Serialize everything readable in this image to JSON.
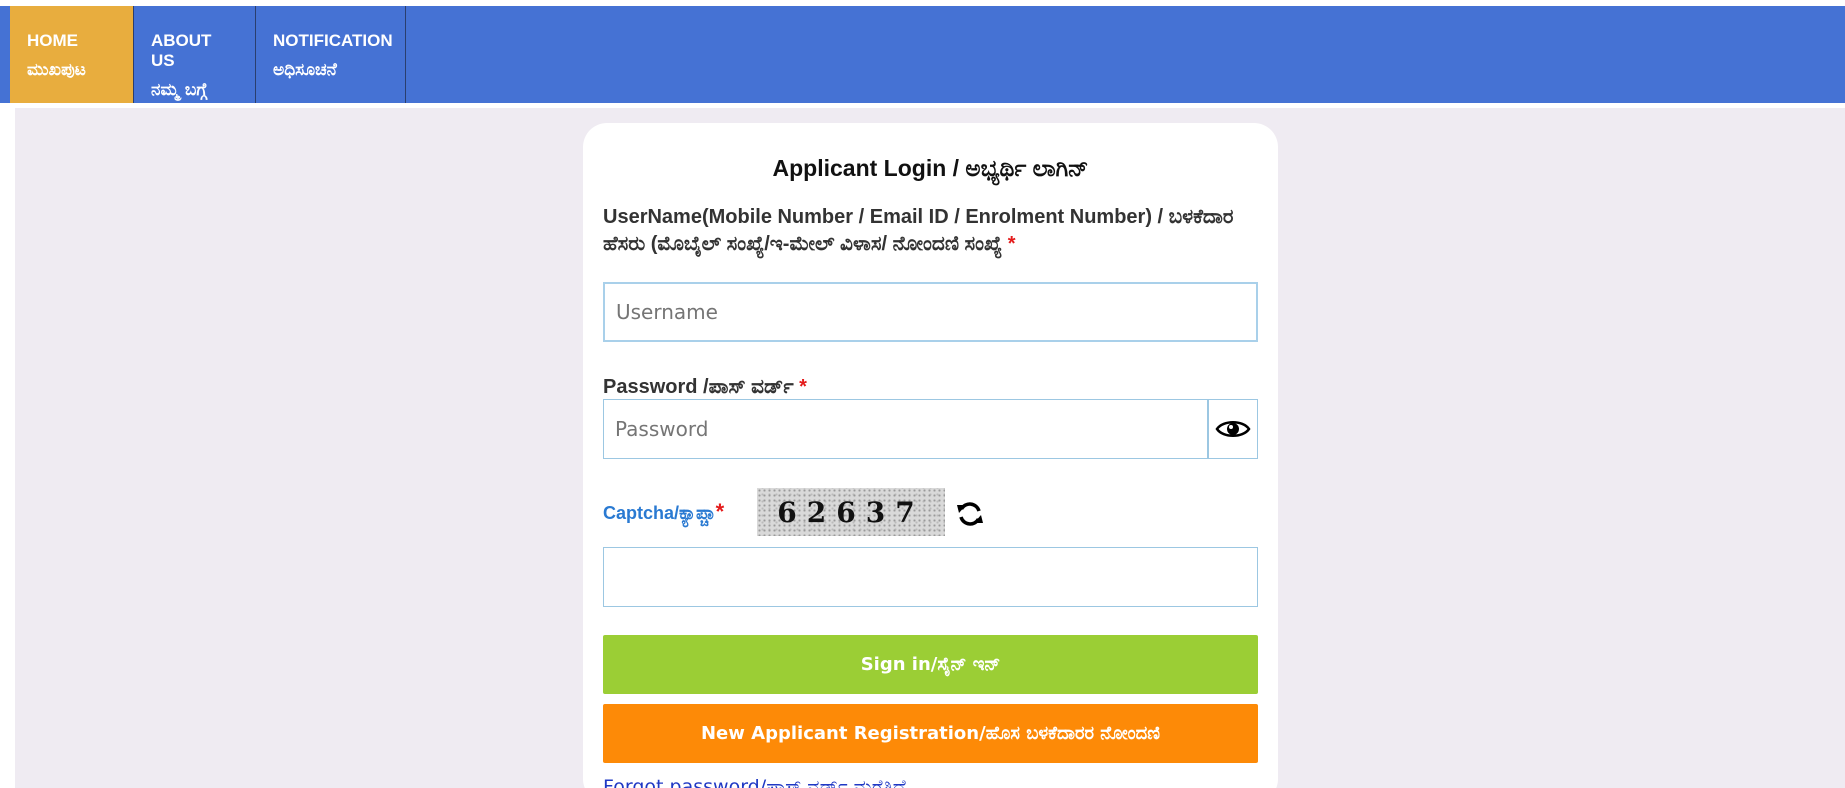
{
  "nav": {
    "home": {
      "en": "HOME",
      "kn": "ಮುಖಪುಟ"
    },
    "about": {
      "en": "ABOUT US",
      "kn": "ನಮ್ಮ ಬಗ್ಗೆ"
    },
    "notification": {
      "en": "NOTIFICATION",
      "kn": "ಅಧಿಸೂಚನೆ"
    }
  },
  "login": {
    "title": "Applicant Login / ಅಭ್ಯರ್ಥಿ ಲಾಗಿನ್",
    "username_label": "UserName(Mobile Number / Email ID / Enrolment Number) / ಬಳಕೆದಾರ ಹೆಸರು (ಮೊಬೈಲ್ ಸಂಖ್ಯೆ/ಇ-ಮೇಲ್ ವಿಳಾಸ/ ನೋಂದಣಿ ಸಂಖ್ಯೆ",
    "username_placeholder": "Username",
    "password_label": "Password /ಪಾಸ್ ವರ್ಡ್",
    "password_placeholder": "Password",
    "required_mark": "*",
    "captcha_label": "Captcha/ಕ್ಯಾಪ್ಚಾ",
    "captcha_text": "62637",
    "captcha_placeholder": "",
    "signin_label": "Sign in/ಸೈನ್ ಇನ್",
    "register_label": "New Applicant Registration/ಹೊಸ ಬಳಕೆದಾರರ ನೋಂದಣಿ",
    "forgot_label": "Forgot password/ಪಾಸ್ ವರ್ಡ್ ಮರೆತಿದೆ"
  },
  "icons": {
    "eye": "eye-icon",
    "refresh": "refresh-icon"
  },
  "colors": {
    "navbar": "#4572d4",
    "nav_active": "#e8ad3e",
    "signin": "#9bce35",
    "register": "#fd8a07",
    "captcha_label": "#2a7ad2",
    "required": "#e41b1b"
  }
}
